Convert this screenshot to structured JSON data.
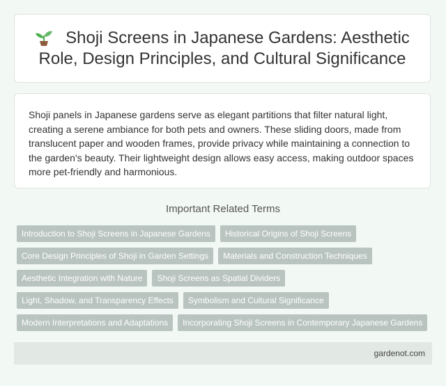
{
  "title": {
    "icon": "sprout-icon",
    "text": "Shoji Screens in Japanese Gardens: Aesthetic Role, Design Principles, and Cultural Significance"
  },
  "summary": {
    "text": "Shoji panels in Japanese gardens serve as elegant partitions that filter natural light, creating a serene ambiance for both pets and owners. These sliding doors, made from translucent paper and wooden frames, provide privacy while maintaining a connection to the garden's beauty. Their lightweight design allows easy access, making outdoor spaces more pet-friendly and harmonious."
  },
  "related": {
    "heading": "Important Related Terms",
    "terms": [
      "Introduction to Shoji Screens in Japanese Gardens",
      "Historical Origins of Shoji Screens",
      "Core Design Principles of Shoji in Garden Settings",
      "Materials and Construction Techniques",
      "Aesthetic Integration with Nature",
      "Shoji Screens as Spatial Dividers",
      "Light, Shadow, and Transparency Effects",
      "Symbolism and Cultural Significance",
      "Modern Interpretations and Adaptations",
      "Incorporating Shoji Screens in Contemporary Japanese Gardens"
    ]
  },
  "footer": {
    "site": "gardenot.com"
  },
  "colors": {
    "background": "#f2f8f4",
    "tag": "#b9c4c0",
    "footer": "#e2e9e5"
  }
}
